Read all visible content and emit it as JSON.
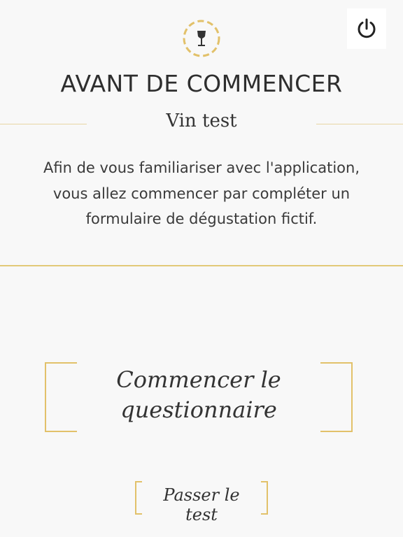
{
  "header": {
    "logo_icon": "wine-glass-icon",
    "power_icon": "power-icon",
    "title": "AVANT DE COMMENCER",
    "subtitle": "Vin test"
  },
  "main": {
    "description": "Afin de vous familiariser avec l'application, vous allez commencer par compléter un formulaire de dégustation fictif.",
    "start_button": "Commencer le questionnaire",
    "skip_button": "Passer le test"
  },
  "colors": {
    "accent": "#e2c16a",
    "background": "#f8f8f8",
    "text": "#333333"
  }
}
